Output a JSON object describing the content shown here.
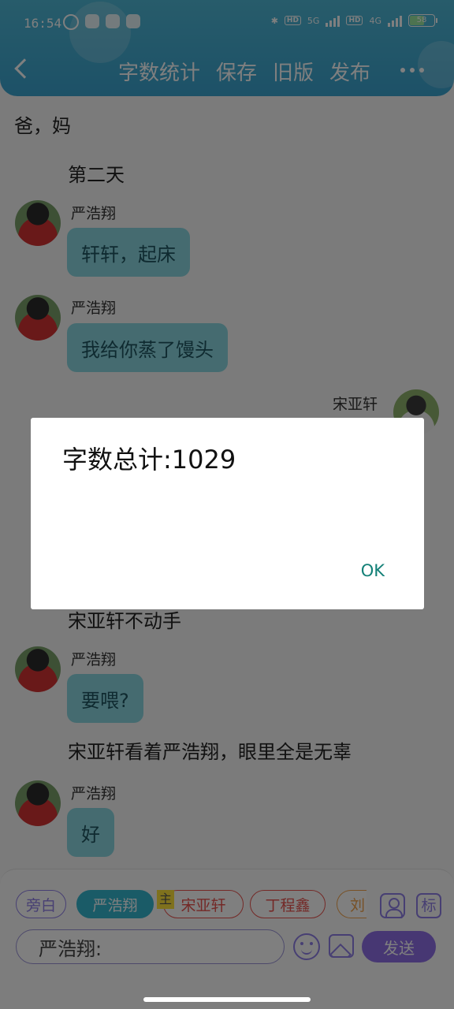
{
  "status_bar": {
    "time": "16:54",
    "net_1": "5G",
    "net_2": "4G",
    "hd": "HD",
    "battery": "58"
  },
  "header": {
    "actions": [
      "字数统计",
      "保存",
      "旧版",
      "发布"
    ]
  },
  "chat": {
    "narration_top": "爸，妈",
    "narration_day": "第二天",
    "messages": [
      {
        "sender": "严浩翔",
        "text": "轩轩，起床"
      },
      {
        "sender": "严浩翔",
        "text": "我给你蒸了馒头"
      },
      {
        "sender": "宋亚轩",
        "text": ""
      },
      {
        "sender": "严浩翔",
        "text": "要喂?"
      },
      {
        "sender": "严浩翔",
        "text": "好"
      }
    ],
    "narration_partial": "宋亚轩不动手",
    "narration_look": "宋亚轩看着严浩翔，眼里全是无辜"
  },
  "dialog": {
    "message": "字数总计:1029",
    "ok_label": "OK"
  },
  "input_panel": {
    "chips": [
      "旁白",
      "严浩翔",
      "宋亚轩",
      "丁程鑫",
      "刘"
    ],
    "main_badge": "主",
    "biao_label": "标",
    "input_value": "严浩翔:",
    "send_label": "发送"
  },
  "colors": {
    "accent": "#35b6cf",
    "bubble": "#8ad7e0",
    "send": "#8f6fe6",
    "ok": "#138077"
  }
}
